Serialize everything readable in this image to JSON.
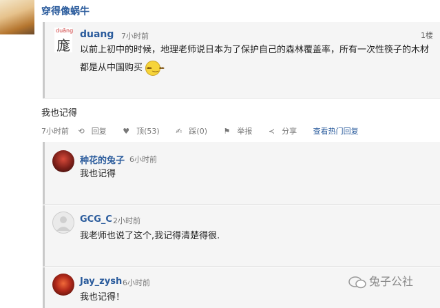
{
  "header": {
    "username": "穿得像蜗牛"
  },
  "quote": {
    "avatar_pinyin": "duāng",
    "avatar_char": "庬",
    "username": "duang",
    "time": "7小时前",
    "floor": "1楼",
    "text": "以前上初中的时候，地理老师说日本为了保护自己的森林覆盖率，所有一次性筷子的木材都是从中国购买"
  },
  "comment": {
    "text": "我也记得",
    "actions": {
      "time": "7小时前",
      "reply": "回复",
      "upvote": "顶(53)",
      "downvote": "踩(0)",
      "report": "举报",
      "share": "分享",
      "hot_replies": "查看热门回复"
    }
  },
  "replies": [
    {
      "username": "种花的兔子",
      "time": "6小时前",
      "text": "我也记得"
    },
    {
      "username": "GCG_C",
      "time": "2小时前",
      "text": "我老师也说了这个,我记得清楚得很."
    },
    {
      "username": "Jay_zysh",
      "time": "6小时前",
      "text": "我也记得！"
    }
  ],
  "watermark": {
    "text": "兔子公社"
  }
}
